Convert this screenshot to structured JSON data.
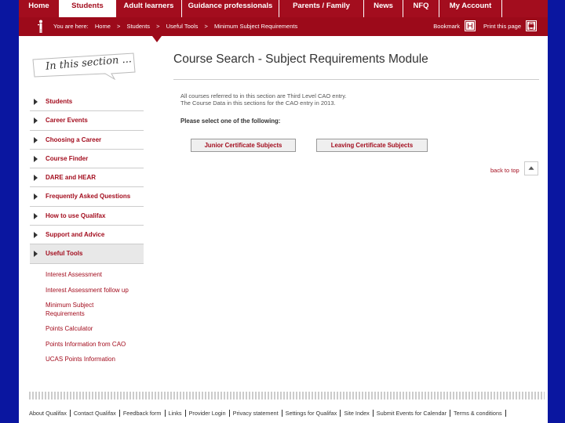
{
  "topnav": {
    "items": [
      {
        "label": "Home"
      },
      {
        "label": "Students"
      },
      {
        "label": "Adult learners"
      },
      {
        "label": "Guidance professionals"
      },
      {
        "label": "Parents / Family"
      },
      {
        "label": "News"
      },
      {
        "label": "NFQ"
      },
      {
        "label": "My Account"
      }
    ],
    "active_index": 1
  },
  "breadcrumb": {
    "prefix": "You are here:",
    "items": [
      "Home",
      ">",
      "Students",
      ">",
      "Useful Tools",
      ">",
      "Minimum Subject Requirements"
    ],
    "bookmark_label": "Bookmark",
    "print_label": "Print this page"
  },
  "sidebar": {
    "section_label": "In this section ...",
    "items": [
      {
        "label": "Students"
      },
      {
        "label": "Career Events"
      },
      {
        "label": "Choosing a Career"
      },
      {
        "label": "Course Finder"
      },
      {
        "label": "DARE and HEAR"
      },
      {
        "label": "Frequently Asked Questions"
      },
      {
        "label": "How to use Qualifax"
      },
      {
        "label": "Support and Advice"
      },
      {
        "label": "Useful Tools"
      }
    ],
    "active_index": 8,
    "subitems": [
      {
        "label": "Interest Assessment"
      },
      {
        "label": "Interest Assessment follow up"
      },
      {
        "label": "Minimum Subject Requirements"
      },
      {
        "label": "Points Calculator"
      },
      {
        "label": "Points Information from CAO"
      },
      {
        "label": "UCAS Points Information"
      }
    ]
  },
  "main": {
    "title": "Course Search - Subject Requirements Module",
    "intro_line1": "All courses referred to in this section are Third Level CAO entry.",
    "intro_line2": "The Course Data in this sections for the CAO entry in 2013.",
    "prompt": "Please select one of the following:",
    "buttons": {
      "junior": "Junior Certificate Subjects",
      "leaving": "Leaving Certificate Subjects"
    },
    "back_to_top": "back to top"
  },
  "footer": {
    "links": [
      "About Qualifax",
      "Contact Qualifax",
      "Feedback form",
      "Links",
      "Provider Login",
      "Privacy statement",
      "Settings for Qualifax",
      "Site Index",
      "Submit Events for Calendar",
      "Terms & conditions"
    ]
  },
  "colors": {
    "page_background": "#0a16a0",
    "brand_red": "#a30d1e",
    "text_dark": "#333333"
  }
}
